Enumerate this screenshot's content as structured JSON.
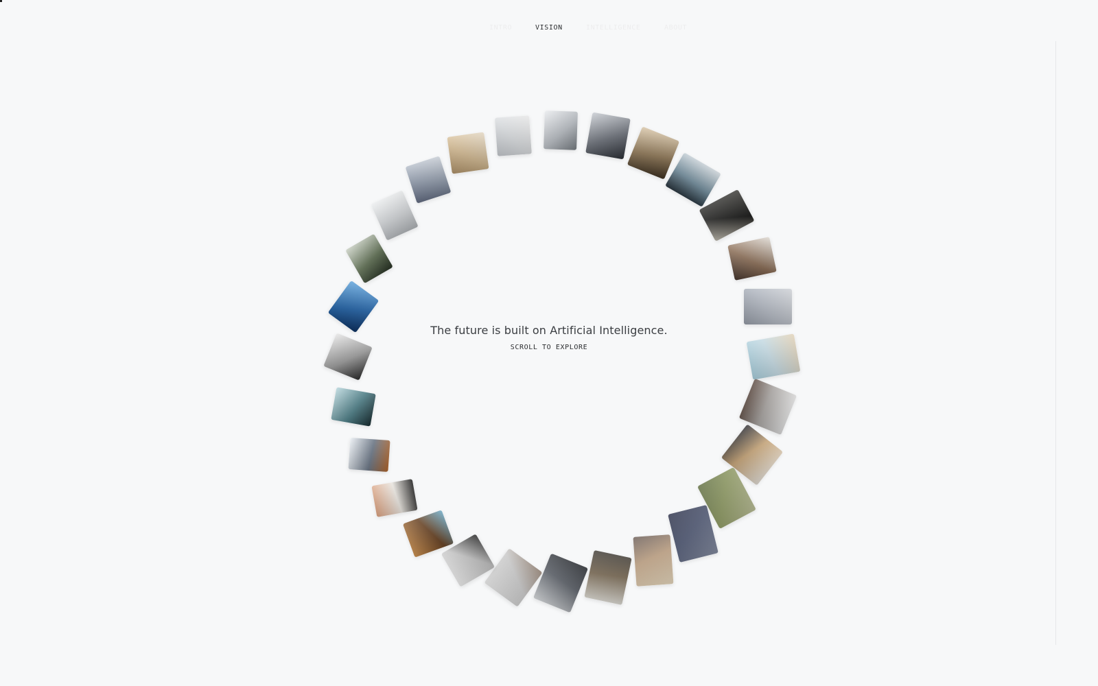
{
  "nav": {
    "items": [
      {
        "id": "intro",
        "label": "INTRO"
      },
      {
        "id": "vision",
        "label": "VISION"
      },
      {
        "id": "intelligence",
        "label": "INTELLIGENCE"
      },
      {
        "id": "about",
        "label": "ABOUT"
      }
    ],
    "active": "vision"
  },
  "hero": {
    "headline": "The future is built on Artificial Intelligence.",
    "cta_label": "SCROLL TO EXPLORE"
  },
  "colors": {
    "background": "#f7f8f9",
    "text_primary": "#2a2c2f",
    "nav_inactive": "#e2e4e6"
  },
  "gallery": {
    "count": 28,
    "tiles": [
      {
        "name": "tile-ceiling-lamp",
        "colors": [
          "#e9ebee",
          "#b9bec4",
          "#7d8389"
        ]
      },
      {
        "name": "tile-dark-curve",
        "colors": [
          "#c8ccd2",
          "#6a6f78",
          "#2d3138"
        ]
      },
      {
        "name": "tile-mushrooms",
        "colors": [
          "#d9c6a8",
          "#8c7452",
          "#3f3222"
        ]
      },
      {
        "name": "tile-curved-window",
        "colors": [
          "#d6dde2",
          "#6e8a9a",
          "#1e2a33"
        ]
      },
      {
        "name": "tile-dark-interior",
        "colors": [
          "#4b4a46",
          "#1d1d1c",
          "#b9b4a8"
        ]
      },
      {
        "name": "tile-cotton",
        "colors": [
          "#eee9e2",
          "#8c6e56",
          "#3a2a22"
        ]
      },
      {
        "name": "tile-grey-machine",
        "colors": [
          "#dfe2e7",
          "#b3b9c3",
          "#8a919c"
        ]
      },
      {
        "name": "tile-pills",
        "colors": [
          "#f3e3c8",
          "#c9dfe8",
          "#9fc7d6"
        ]
      },
      {
        "name": "tile-perforated-room",
        "colors": [
          "#e6e6e6",
          "#a9a5a2",
          "#5d4b42"
        ]
      },
      {
        "name": "tile-figure-table",
        "colors": [
          "#ece7df",
          "#c9a678",
          "#2d2e33"
        ]
      },
      {
        "name": "tile-green-landscape",
        "colors": [
          "#c5c9a1",
          "#8e9a62",
          "#5c6a3d"
        ]
      },
      {
        "name": "tile-blue-dusk",
        "colors": [
          "#8b93a8",
          "#4f5874",
          "#2b3048"
        ]
      },
      {
        "name": "tile-corridor-light",
        "colors": [
          "#f1e2c7",
          "#c7a98a",
          "#6a5c56"
        ]
      },
      {
        "name": "tile-table-room",
        "colors": [
          "#e8e6df",
          "#7a6a54",
          "#3e3a34"
        ]
      },
      {
        "name": "tile-people-crowd",
        "colors": [
          "#dcdfe2",
          "#5b6068",
          "#23262b"
        ]
      },
      {
        "name": "tile-white-kitchen",
        "colors": [
          "#f2f2f2",
          "#cfcfcf",
          "#8c7a6c"
        ]
      },
      {
        "name": "tile-sketch",
        "colors": [
          "#eeeeee",
          "#c7c7c7",
          "#2b2b2b"
        ]
      },
      {
        "name": "tile-orange-orb",
        "colors": [
          "#c98a46",
          "#6a4323",
          "#78b8d6"
        ]
      },
      {
        "name": "tile-headphones",
        "colors": [
          "#d89a76",
          "#f1ede7",
          "#222222"
        ]
      },
      {
        "name": "tile-glass-ceiling",
        "colors": [
          "#e9eef3",
          "#6a7686",
          "#b86a2e"
        ]
      },
      {
        "name": "tile-teal-light",
        "colors": [
          "#b7d6dc",
          "#4c7f88",
          "#1a2f34"
        ]
      },
      {
        "name": "tile-black-jet",
        "colors": [
          "#e7e7e7",
          "#9c9c9c",
          "#2c2c2c"
        ]
      },
      {
        "name": "tile-blue-sky",
        "colors": [
          "#5fa4dc",
          "#1c5fa6",
          "#0d3264"
        ]
      },
      {
        "name": "tile-forest-hill",
        "colors": [
          "#c9d0c3",
          "#5e6f52",
          "#2a3526"
        ]
      },
      {
        "name": "tile-grey-fog",
        "colors": [
          "#eef0f1",
          "#d3d6d9",
          "#b4b8bc"
        ]
      },
      {
        "name": "tile-steel-blue",
        "colors": [
          "#d4dae2",
          "#8f9aab",
          "#59637a"
        ]
      },
      {
        "name": "tile-sand-dune",
        "colors": [
          "#f0e4d0",
          "#d2b88f",
          "#a88a60"
        ]
      },
      {
        "name": "tile-mist-window",
        "colors": [
          "#f4f4f4",
          "#dcdfe2",
          "#c1c5ca"
        ]
      }
    ]
  }
}
